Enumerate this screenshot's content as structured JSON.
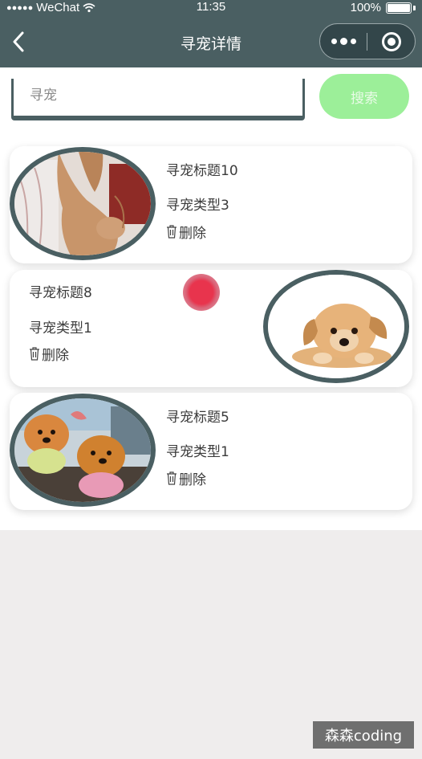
{
  "status_bar": {
    "carrier": "WeChat",
    "time": "11:35",
    "battery": "100%"
  },
  "nav": {
    "title": "寻宠详情"
  },
  "search": {
    "placeholder": "寻宠",
    "value": "",
    "button_label": "搜索"
  },
  "pets": [
    {
      "title": "寻宠标题10",
      "type": "寻宠类型3",
      "delete_label": "删除",
      "photo": "cat-photo"
    },
    {
      "title": "寻宠标题8",
      "type": "寻宠类型1",
      "delete_label": "删除",
      "photo": "puppy-photo"
    },
    {
      "title": "寻宠标题5",
      "type": "寻宠类型1",
      "delete_label": "删除",
      "photo": "pomeranian-photo"
    }
  ],
  "watermark": "森森coding",
  "colors": {
    "header": "#4a5f62",
    "search_button": "#9cef99",
    "photo_border": "#4a5f62",
    "bottom_background": "#efeded"
  }
}
